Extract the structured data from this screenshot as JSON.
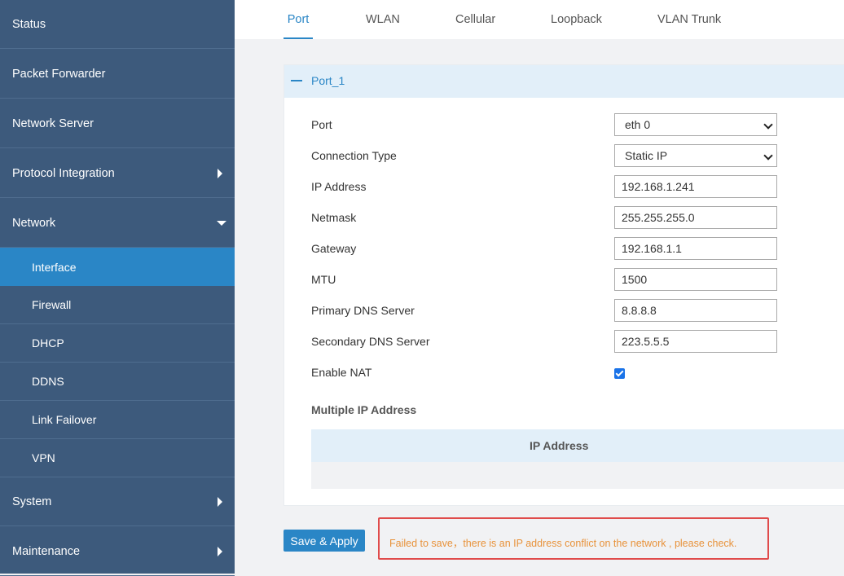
{
  "sidebar": {
    "items": [
      {
        "label": "Status"
      },
      {
        "label": "Packet Forwarder"
      },
      {
        "label": "Network Server"
      },
      {
        "label": "Protocol Integration"
      },
      {
        "label": "Network"
      },
      {
        "label": "System"
      },
      {
        "label": "Maintenance"
      }
    ],
    "network_sub": [
      {
        "label": "Interface"
      },
      {
        "label": "Firewall"
      },
      {
        "label": "DHCP"
      },
      {
        "label": "DDNS"
      },
      {
        "label": "Link Failover"
      },
      {
        "label": "VPN"
      }
    ]
  },
  "tabs": [
    {
      "label": "Port"
    },
    {
      "label": "WLAN"
    },
    {
      "label": "Cellular"
    },
    {
      "label": "Loopback"
    },
    {
      "label": "VLAN Trunk"
    }
  ],
  "panel": {
    "title": "Port_1",
    "fields": {
      "port": {
        "label": "Port",
        "value": "eth 0"
      },
      "connection_type": {
        "label": "Connection Type",
        "value": "Static IP"
      },
      "ip_address": {
        "label": "IP Address",
        "value": "192.168.1.241"
      },
      "netmask": {
        "label": "Netmask",
        "value": "255.255.255.0"
      },
      "gateway": {
        "label": "Gateway",
        "value": "192.168.1.1"
      },
      "mtu": {
        "label": "MTU",
        "value": "1500"
      },
      "primary_dns": {
        "label": "Primary DNS Server",
        "value": "8.8.8.8"
      },
      "secondary_dns": {
        "label": "Secondary DNS Server",
        "value": "223.5.5.5"
      },
      "enable_nat": {
        "label": "Enable NAT",
        "checked": true
      }
    },
    "multiple_ip": {
      "title": "Multiple IP Address",
      "column": "IP Address"
    }
  },
  "actions": {
    "save_label": "Save & Apply"
  },
  "error": {
    "message": "Failed to save，there is an IP address conflict on the network , please check."
  },
  "colors": {
    "sidebar_bg": "#3d5a7c",
    "accent": "#2a86c6",
    "error_border": "#e04b4b",
    "error_text": "#e8923a"
  }
}
